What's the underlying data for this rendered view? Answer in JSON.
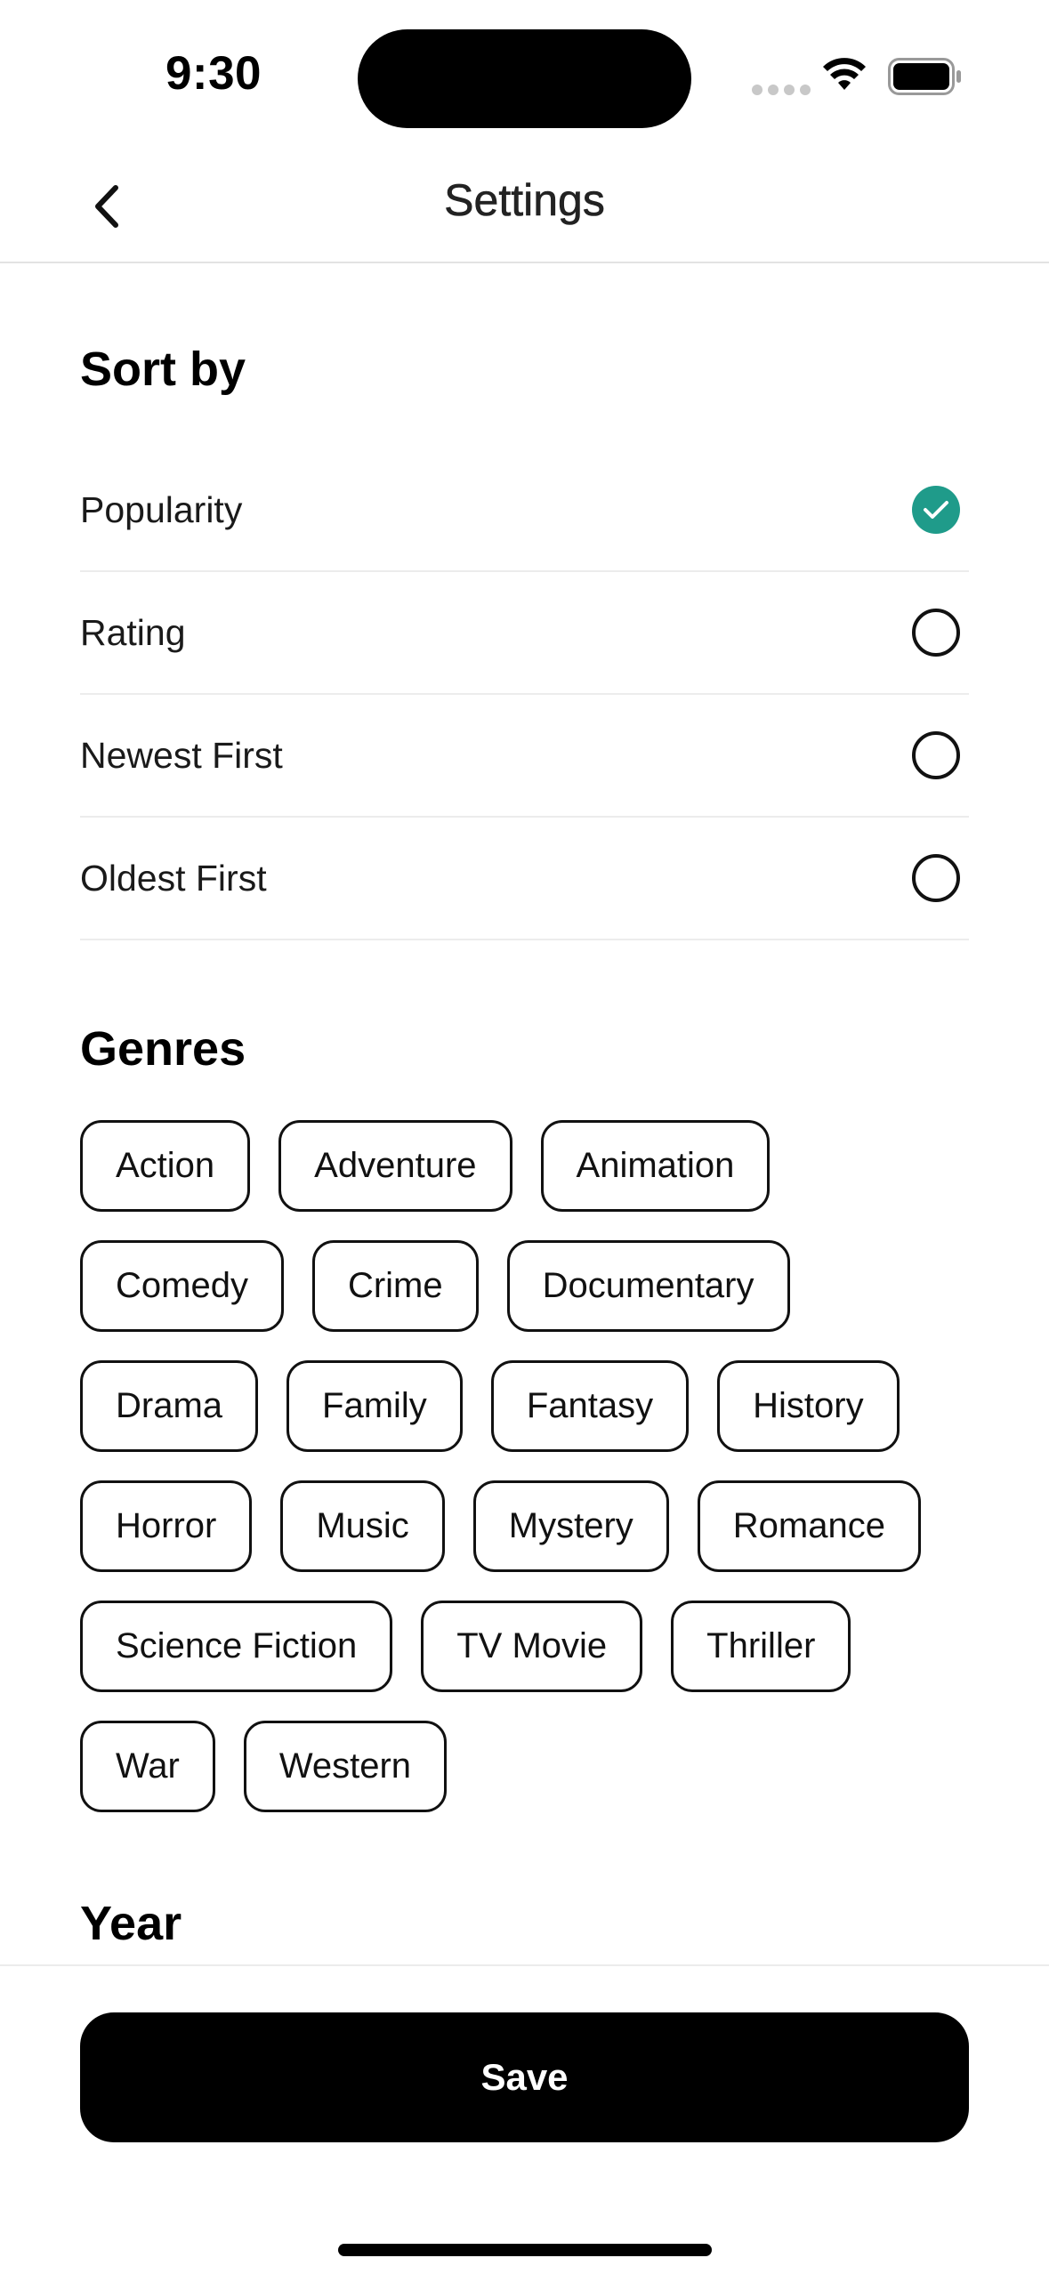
{
  "status_bar": {
    "time": "9:30"
  },
  "nav": {
    "title": "Settings",
    "back_icon": "chevron-left-icon"
  },
  "sort": {
    "title": "Sort by",
    "options": [
      {
        "label": "Popularity",
        "selected": true
      },
      {
        "label": "Rating",
        "selected": false
      },
      {
        "label": "Newest First",
        "selected": false
      },
      {
        "label": "Oldest First",
        "selected": false
      }
    ]
  },
  "genres": {
    "title": "Genres",
    "items": [
      "Action",
      "Adventure",
      "Animation",
      "Comedy",
      "Crime",
      "Documentary",
      "Drama",
      "Family",
      "Fantasy",
      "History",
      "Horror",
      "Music",
      "Mystery",
      "Romance",
      "Science Fiction",
      "TV Movie",
      "Thriller",
      "War",
      "Western"
    ]
  },
  "year": {
    "title": "Year"
  },
  "footer": {
    "save_label": "Save"
  },
  "colors": {
    "accent": "#1f9b8a",
    "primary_button": "#000000"
  }
}
